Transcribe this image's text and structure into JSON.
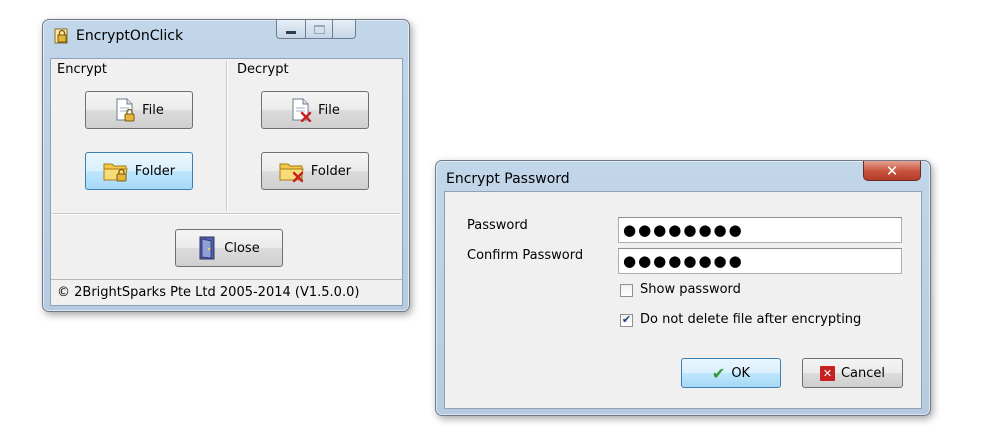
{
  "encrypt_app": {
    "title": "EncryptOnClick",
    "encrypt_group": {
      "label": "Encrypt",
      "file_button": "File",
      "folder_button": "Folder"
    },
    "decrypt_group": {
      "label": "Decrypt",
      "file_button": "File",
      "folder_button": "Folder"
    },
    "close_button": "Close",
    "status": "© 2BrightSparks Pte Ltd 2005-2014 (V1.5.0.0)"
  },
  "password_dialog": {
    "title": "Encrypt Password",
    "password_label": "Password",
    "password_value": "●●●●●●●●",
    "confirm_label": "Confirm Password",
    "confirm_value": "●●●●●●●●",
    "show_password": {
      "label": "Show password",
      "checked": false
    },
    "keep_file": {
      "label": "Do not delete file after encrypting",
      "checked": true
    },
    "ok_button": "OK",
    "cancel_button": "Cancel"
  }
}
